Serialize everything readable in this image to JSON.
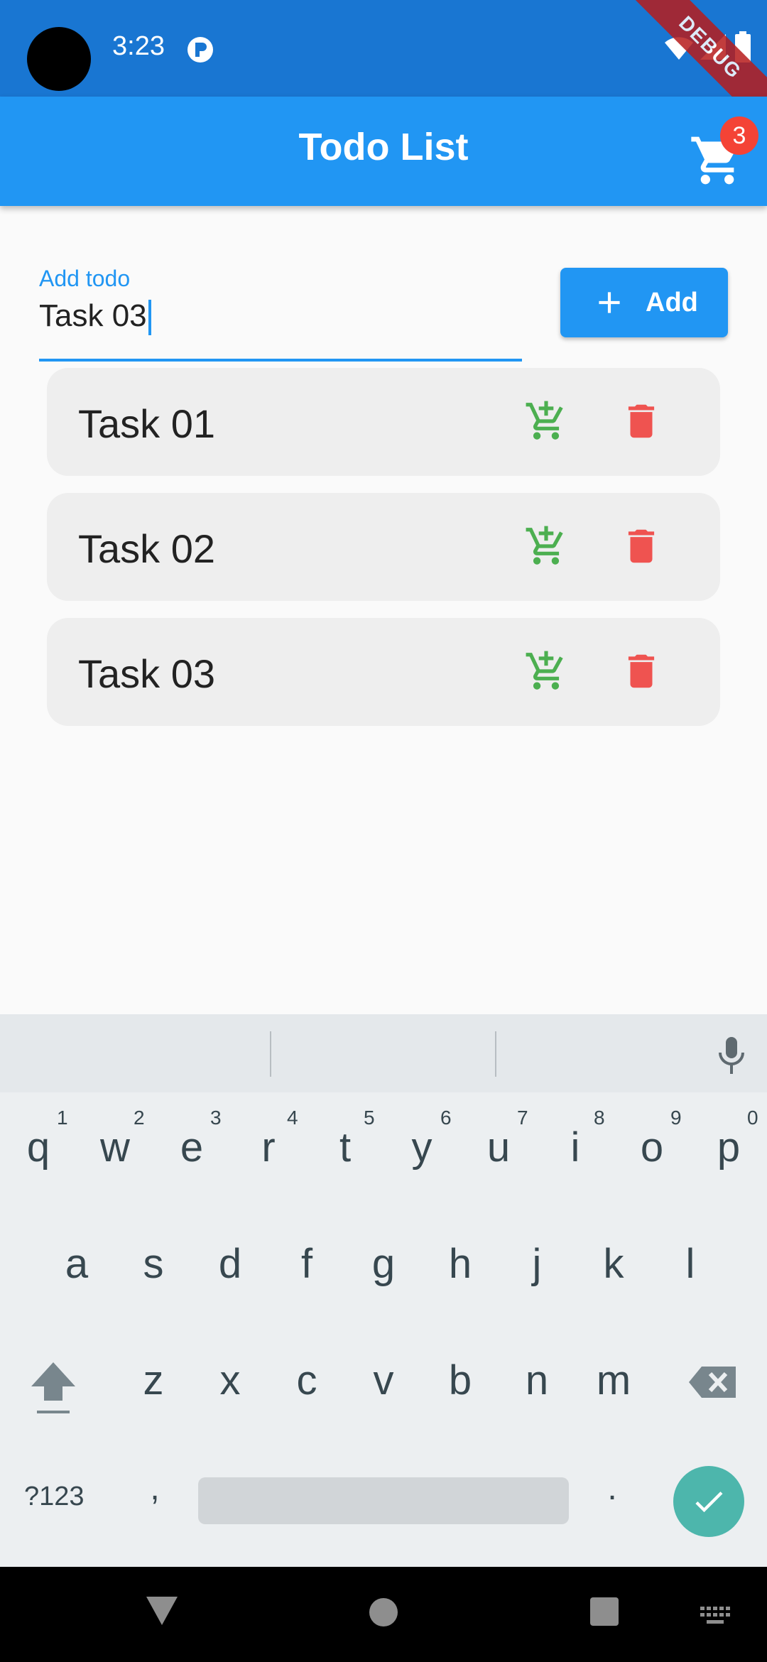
{
  "status_bar": {
    "time": "3:23",
    "debug_label": "DEBUG",
    "icons": [
      "camera-cutout",
      "app-notification-icon",
      "wifi-icon",
      "signal-icon",
      "battery-icon"
    ]
  },
  "app_bar": {
    "title": "Todo List",
    "cart_badge_count": "3",
    "color": "#2196f3"
  },
  "input": {
    "label": "Add todo",
    "value": "Task 03"
  },
  "add_button": {
    "label": "Add",
    "icon": "plus-icon"
  },
  "tasks": [
    {
      "label": "Task 01",
      "cart_icon": "add-shopping-cart-icon",
      "delete_icon": "trash-icon"
    },
    {
      "label": "Task 02",
      "cart_icon": "add-shopping-cart-icon",
      "delete_icon": "trash-icon"
    },
    {
      "label": "Task 03",
      "cart_icon": "add-shopping-cart-icon",
      "delete_icon": "trash-icon"
    }
  ],
  "colors": {
    "cart_green": "#4caf50",
    "delete_red": "#ef5350",
    "badge_red": "#f44336",
    "accent": "#2196f3"
  },
  "keyboard": {
    "row1": [
      "q",
      "w",
      "e",
      "r",
      "t",
      "y",
      "u",
      "i",
      "o",
      "p"
    ],
    "row1_numbers": [
      "1",
      "2",
      "3",
      "4",
      "5",
      "6",
      "7",
      "8",
      "9",
      "0"
    ],
    "row2": [
      "a",
      "s",
      "d",
      "f",
      "g",
      "h",
      "j",
      "k",
      "l"
    ],
    "row3": [
      "z",
      "x",
      "c",
      "v",
      "b",
      "n",
      "m"
    ],
    "symbols_key": "?123",
    "comma_key": ",",
    "period_key": "."
  }
}
